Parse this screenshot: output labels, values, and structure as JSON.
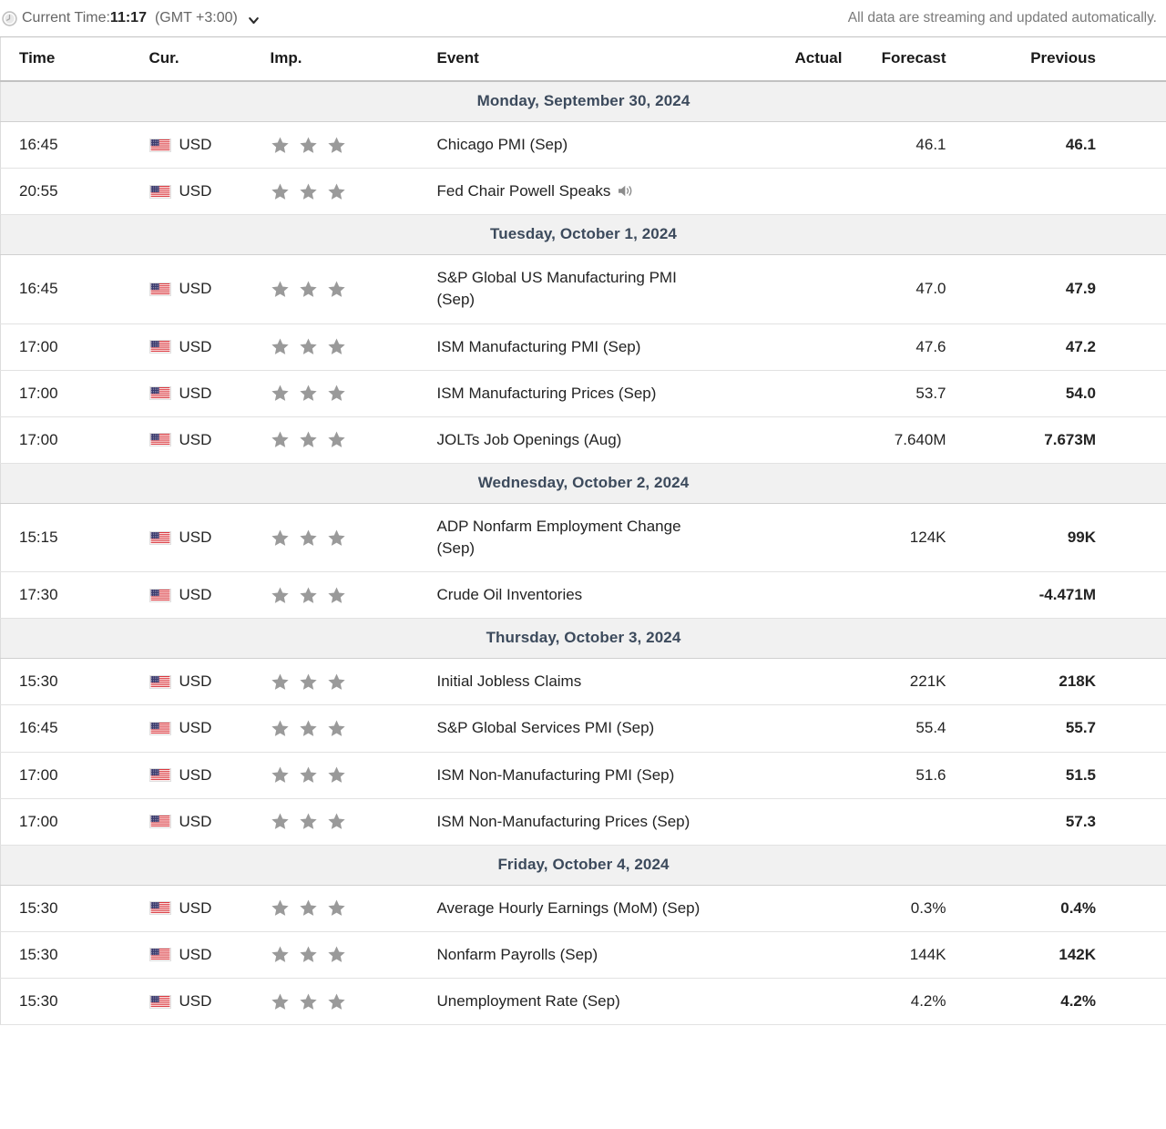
{
  "header": {
    "clock_icon": "clock-icon",
    "current_time_label": "Current Time:",
    "current_time_value": "11:17",
    "timezone": "(GMT +3:00)",
    "caret_icon": "chevron-down-icon",
    "streaming_note": "All data are streaming and updated automatically."
  },
  "columns": {
    "time": "Time",
    "currency": "Cur.",
    "importance": "Imp.",
    "event": "Event",
    "actual": "Actual",
    "forecast": "Forecast",
    "previous": "Previous"
  },
  "colors": {
    "day_header_text": "#3c4a5c",
    "day_header_bg": "#f1f1f1",
    "star_inactive": "#9a9a9a",
    "body_text": "#232323",
    "muted_text": "#7a7a7a",
    "row_border": "#e2e2e2"
  },
  "days": [
    {
      "date": "Monday, September 30, 2024",
      "events": [
        {
          "time": "16:45",
          "currency": "USD",
          "flag": "us-flag-icon",
          "stars_total": 3,
          "stars_filled": 0,
          "event": "Chicago PMI (Sep)",
          "has_sound": false,
          "actual": "",
          "forecast": "46.1",
          "previous": "46.1"
        },
        {
          "time": "20:55",
          "currency": "USD",
          "flag": "us-flag-icon",
          "stars_total": 3,
          "stars_filled": 0,
          "event": "Fed Chair Powell Speaks",
          "has_sound": true,
          "actual": "",
          "forecast": "",
          "previous": ""
        }
      ]
    },
    {
      "date": "Tuesday, October 1, 2024",
      "events": [
        {
          "time": "16:45",
          "currency": "USD",
          "flag": "us-flag-icon",
          "stars_total": 3,
          "stars_filled": 0,
          "event": "S&P Global US Manufacturing PMI (Sep)",
          "has_sound": false,
          "actual": "",
          "forecast": "47.0",
          "previous": "47.9"
        },
        {
          "time": "17:00",
          "currency": "USD",
          "flag": "us-flag-icon",
          "stars_total": 3,
          "stars_filled": 0,
          "event": "ISM Manufacturing PMI (Sep)",
          "has_sound": false,
          "actual": "",
          "forecast": "47.6",
          "previous": "47.2"
        },
        {
          "time": "17:00",
          "currency": "USD",
          "flag": "us-flag-icon",
          "stars_total": 3,
          "stars_filled": 0,
          "event": "ISM Manufacturing Prices (Sep)",
          "has_sound": false,
          "actual": "",
          "forecast": "53.7",
          "previous": "54.0"
        },
        {
          "time": "17:00",
          "currency": "USD",
          "flag": "us-flag-icon",
          "stars_total": 3,
          "stars_filled": 0,
          "event": "JOLTs Job Openings (Aug)",
          "has_sound": false,
          "actual": "",
          "forecast": "7.640M",
          "previous": "7.673M"
        }
      ]
    },
    {
      "date": "Wednesday, October 2, 2024",
      "events": [
        {
          "time": "15:15",
          "currency": "USD",
          "flag": "us-flag-icon",
          "stars_total": 3,
          "stars_filled": 0,
          "event": "ADP Nonfarm Employment Change (Sep)",
          "has_sound": false,
          "actual": "",
          "forecast": "124K",
          "previous": "99K"
        },
        {
          "time": "17:30",
          "currency": "USD",
          "flag": "us-flag-icon",
          "stars_total": 3,
          "stars_filled": 0,
          "event": "Crude Oil Inventories",
          "has_sound": false,
          "actual": "",
          "forecast": "",
          "previous": "-4.471M"
        }
      ]
    },
    {
      "date": "Thursday, October 3, 2024",
      "events": [
        {
          "time": "15:30",
          "currency": "USD",
          "flag": "us-flag-icon",
          "stars_total": 3,
          "stars_filled": 0,
          "event": "Initial Jobless Claims",
          "has_sound": false,
          "actual": "",
          "forecast": "221K",
          "previous": "218K"
        },
        {
          "time": "16:45",
          "currency": "USD",
          "flag": "us-flag-icon",
          "stars_total": 3,
          "stars_filled": 0,
          "event": "S&P Global Services PMI (Sep)",
          "has_sound": false,
          "actual": "",
          "forecast": "55.4",
          "previous": "55.7"
        },
        {
          "time": "17:00",
          "currency": "USD",
          "flag": "us-flag-icon",
          "stars_total": 3,
          "stars_filled": 0,
          "event": "ISM Non-Manufacturing PMI (Sep)",
          "has_sound": false,
          "actual": "",
          "forecast": "51.6",
          "previous": "51.5"
        },
        {
          "time": "17:00",
          "currency": "USD",
          "flag": "us-flag-icon",
          "stars_total": 3,
          "stars_filled": 0,
          "event": "ISM Non-Manufacturing Prices (Sep)",
          "has_sound": false,
          "actual": "",
          "forecast": "",
          "previous": "57.3"
        }
      ]
    },
    {
      "date": "Friday, October 4, 2024",
      "events": [
        {
          "time": "15:30",
          "currency": "USD",
          "flag": "us-flag-icon",
          "stars_total": 3,
          "stars_filled": 0,
          "event": "Average Hourly Earnings (MoM) (Sep)",
          "has_sound": false,
          "actual": "",
          "forecast": "0.3%",
          "previous": "0.4%"
        },
        {
          "time": "15:30",
          "currency": "USD",
          "flag": "us-flag-icon",
          "stars_total": 3,
          "stars_filled": 0,
          "event": "Nonfarm Payrolls (Sep)",
          "has_sound": false,
          "actual": "",
          "forecast": "144K",
          "previous": "142K"
        },
        {
          "time": "15:30",
          "currency": "USD",
          "flag": "us-flag-icon",
          "stars_total": 3,
          "stars_filled": 0,
          "event": "Unemployment Rate (Sep)",
          "has_sound": false,
          "actual": "",
          "forecast": "4.2%",
          "previous": "4.2%"
        }
      ]
    }
  ]
}
